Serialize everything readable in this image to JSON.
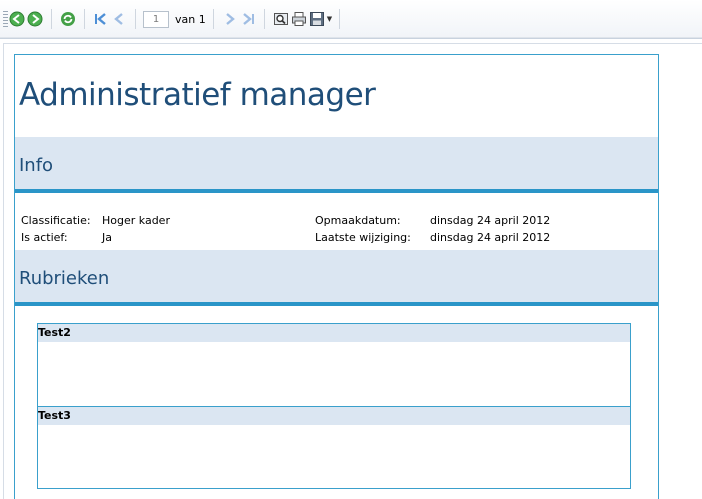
{
  "toolbar": {
    "page_current": "1",
    "page_of": "van 1",
    "icons": [
      "back-arrow-icon",
      "forward-arrow-icon",
      "refresh-icon",
      "first-page-icon",
      "previous-page-icon",
      "next-page-icon",
      "last-page-icon",
      "find-icon",
      "print-icon",
      "save-icon"
    ]
  },
  "report": {
    "title": "Administratief manager",
    "sections": {
      "info": "Info",
      "rubrieken": "Rubrieken"
    },
    "properties": {
      "classificatie_label": "Classificatie:",
      "classificatie_value": "Hoger kader",
      "actief_label": "Is actief:",
      "actief_value": "Ja",
      "opmaak_label": "Opmaakdatum:",
      "opmaak_value": "dinsdag 24 april 2012",
      "wijziging_label": "Laatste wijziging:",
      "wijziging_value": "dinsdag 24 april 2012"
    },
    "rubrieken": [
      {
        "name": "Test2"
      },
      {
        "name": "Test3"
      }
    ]
  },
  "colors": {
    "title": "#1f4e79",
    "band": "#dbe6f2",
    "accent": "#2a95c8",
    "green_nav": "#4caf50",
    "blue_nav": "#4d8fd6"
  }
}
